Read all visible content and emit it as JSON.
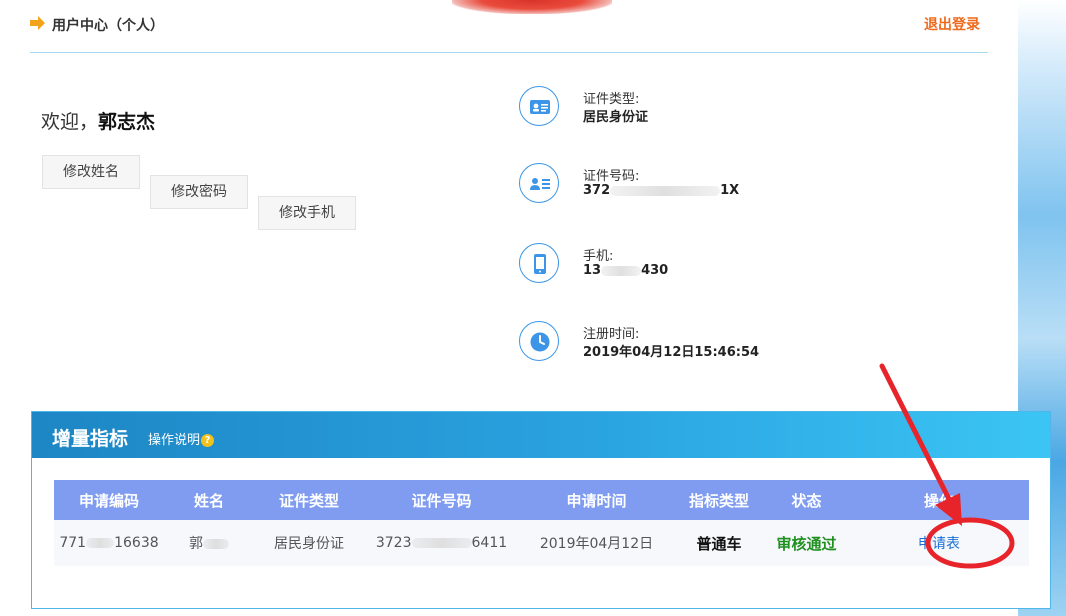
{
  "header": {
    "title": "用户中心（个人）",
    "logout": "退出登录"
  },
  "welcome": {
    "prefix": "欢迎，",
    "name": "郭志杰"
  },
  "actions": {
    "edit_name": "修改姓名",
    "edit_password": "修改密码",
    "edit_phone": "修改手机"
  },
  "info": {
    "id_type_label": "证件类型:",
    "id_type_value": "居民身份证",
    "id_number_label": "证件号码:",
    "id_number_prefix": "372",
    "id_number_suffix": "1X",
    "phone_label": "手机:",
    "phone_prefix": "13",
    "phone_suffix": "430",
    "reg_time_label": "注册时间:",
    "reg_time_value": "2019年04月12日15:46:54"
  },
  "panel": {
    "title": "增量指标",
    "help": "操作说明",
    "help_icon": "?",
    "columns": [
      "申请编码",
      "姓名",
      "证件类型",
      "证件号码",
      "申请时间",
      "指标类型",
      "状态",
      "操作"
    ],
    "row": {
      "code_prefix": "771",
      "code_suffix": "16638",
      "name": "郭",
      "id_type": "居民身份证",
      "id_prefix": "3723",
      "id_suffix": "6411",
      "apply_time": "2019年04月12日",
      "indicator_type": "普通车",
      "status": "审核通过",
      "operation": "申请表"
    }
  },
  "colors": {
    "accent_orange": "#ee6a1d",
    "panel_blue": "#2aa3e0",
    "table_header": "#7f9cf0",
    "status_green": "#1f8f1f",
    "link_blue": "#1a6fd6",
    "annotation_red": "#e8242b"
  }
}
